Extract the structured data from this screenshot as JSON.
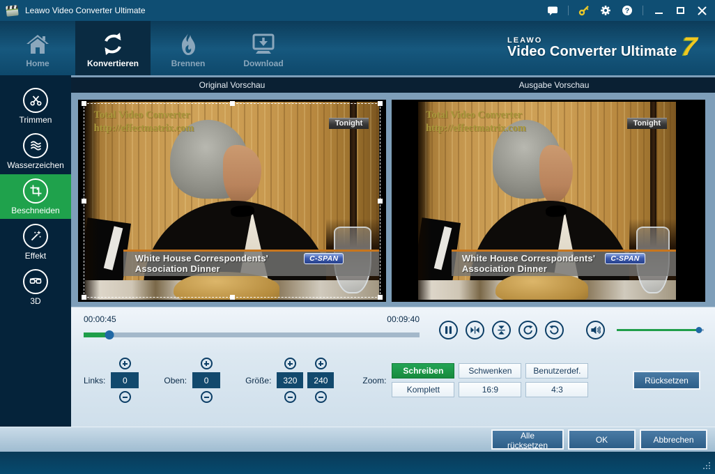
{
  "window": {
    "title": "Leawo Video Converter Ultimate"
  },
  "titlebar": {
    "icons": [
      "clapperboard-app-icon",
      "feedback-bubble-icon",
      "register-key-icon",
      "settings-gear-icon",
      "help-question-icon",
      "minimize-icon",
      "maximize-icon",
      "close-icon"
    ]
  },
  "nav": {
    "items": [
      {
        "label": "Home",
        "icon": "home-icon",
        "active": false
      },
      {
        "label": "Konvertieren",
        "icon": "sync-arrows-icon",
        "active": true
      },
      {
        "label": "Brennen",
        "icon": "flame-icon",
        "active": false
      },
      {
        "label": "Download",
        "icon": "download-monitor-icon",
        "active": false
      }
    ],
    "logo": {
      "brand": "LEAWO",
      "product": "Video Converter Ultimate",
      "version": "7"
    }
  },
  "sidebar": {
    "items": [
      {
        "label": "Trimmen",
        "icon": "scissors-icon",
        "active": false
      },
      {
        "label": "Wasserzeichen",
        "icon": "waves-icon",
        "active": false
      },
      {
        "label": "Beschneiden",
        "icon": "crop-icon",
        "active": true
      },
      {
        "label": "Effekt",
        "icon": "magic-wand-icon",
        "active": false
      },
      {
        "label": "3D",
        "icon": "3d-glasses-icon",
        "active": false
      }
    ]
  },
  "preview": {
    "original_title": "Original Vorschau",
    "output_title": "Ausgabe Vorschau",
    "video": {
      "watermark_line1": "Total Video Converter",
      "watermark_line2": "http://effectmatrix.com",
      "badge_top_right": "Tonight",
      "caption_line1": "White House Correspondents'",
      "caption_line2": "Association Dinner",
      "channel_logo": "C-SPAN"
    }
  },
  "playback": {
    "elapsed": "00:00:45",
    "duration": "00:09:40",
    "progress_percent": 7.7,
    "volume_percent": 94,
    "buttons": [
      "pause",
      "flip-horizontal",
      "flip-vertical",
      "rotate-clockwise",
      "rotate-counterclockwise",
      "volume"
    ]
  },
  "crop_controls": {
    "left_label": "Links:",
    "left_value": "0",
    "top_label": "Oben:",
    "top_value": "0",
    "size_label": "Größe:",
    "width_value": "320",
    "height_value": "240",
    "zoom_label": "Zoom:",
    "zoom_buttons": [
      {
        "label": "Schreiben",
        "active": true
      },
      {
        "label": "Schwenken",
        "active": false
      },
      {
        "label": "Benutzerdef.",
        "active": false
      },
      {
        "label": "Komplett",
        "active": false
      },
      {
        "label": "16:9",
        "active": false
      },
      {
        "label": "4:3",
        "active": false
      }
    ],
    "reset_label": "Rücksetzen"
  },
  "footer": {
    "buttons": [
      {
        "label": "Alle rücksetzen"
      },
      {
        "label": "OK"
      },
      {
        "label": "Abbrechen"
      }
    ]
  },
  "colors": {
    "titlebar": "#0f4e73",
    "sidebar": "#05233a",
    "accent_green": "#1fa24c",
    "button_green": "#1b9145",
    "steel_button": "#3a6d96",
    "main_bg": "#7e9eb9",
    "panel_light": "#d9e6f0",
    "key_icon": "#e8c62a",
    "version_gold": "#f3c71f"
  }
}
